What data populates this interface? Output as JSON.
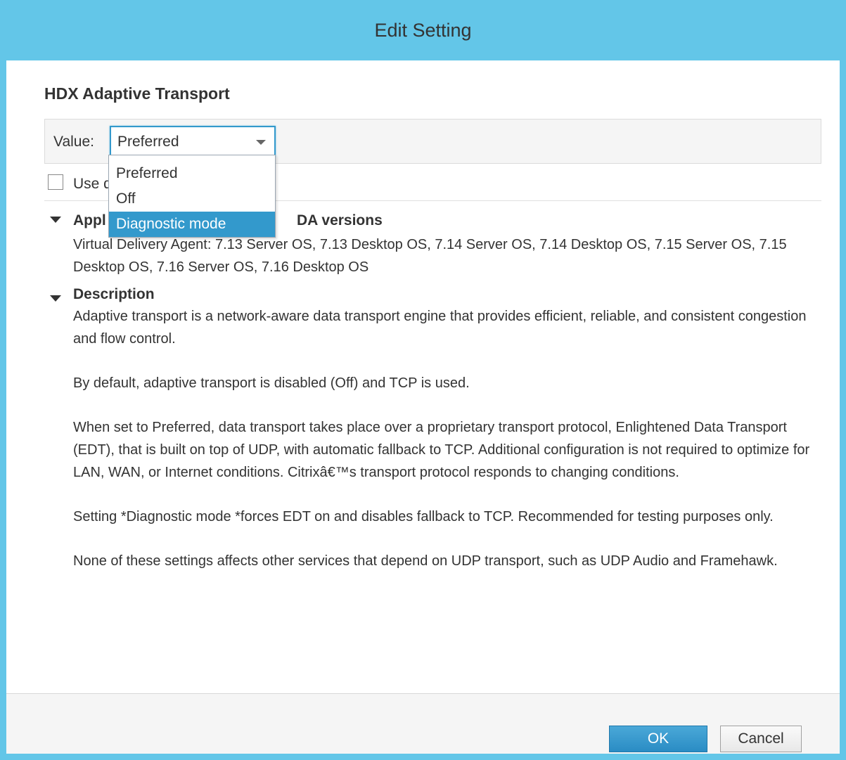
{
  "window": {
    "title": "Edit Setting"
  },
  "setting": {
    "name": "HDX Adaptive Transport",
    "value_label": "Value:",
    "selected_value": "Preferred",
    "options": [
      "Preferred",
      "Off",
      "Diagnostic mode"
    ],
    "highlighted_option": "Diagnostic mode",
    "default_checkbox_label": "Use d",
    "default_checkbox_checked": false
  },
  "applies_to": {
    "title_visible": "Appl",
    "title_suffix": "DA versions",
    "text": "Virtual Delivery Agent: 7.13 Server OS, 7.13 Desktop OS, 7.14 Server OS, 7.14 Desktop OS, 7.15 Server OS, 7.15 Desktop OS, 7.16 Server OS, 7.16 Desktop OS"
  },
  "description": {
    "title": "Description",
    "paragraphs": [
      "Adaptive transport is a network-aware data transport engine that provides efficient, reliable, and consistent congestion and flow control.",
      "By default, adaptive transport is disabled (Off) and TCP is used.",
      "When set to Preferred, data transport takes place over a proprietary transport protocol, Enlightened Data Transport (EDT), that is built on top of UDP, with automatic fallback to TCP. Additional configuration is not required to optimize for LAN, WAN, or Internet conditions. Citrixâ€™s transport protocol responds to changing conditions.",
      "Setting *Diagnostic mode *forces EDT on and disables fallback to TCP. Recommended for testing purposes only.",
      "None of these settings affects other services that depend on UDP transport, such as UDP Audio and Framehawk."
    ]
  },
  "buttons": {
    "ok": "OK",
    "cancel": "Cancel"
  },
  "colors": {
    "title_bar": "#63c6e8",
    "accent": "#3399cc"
  }
}
